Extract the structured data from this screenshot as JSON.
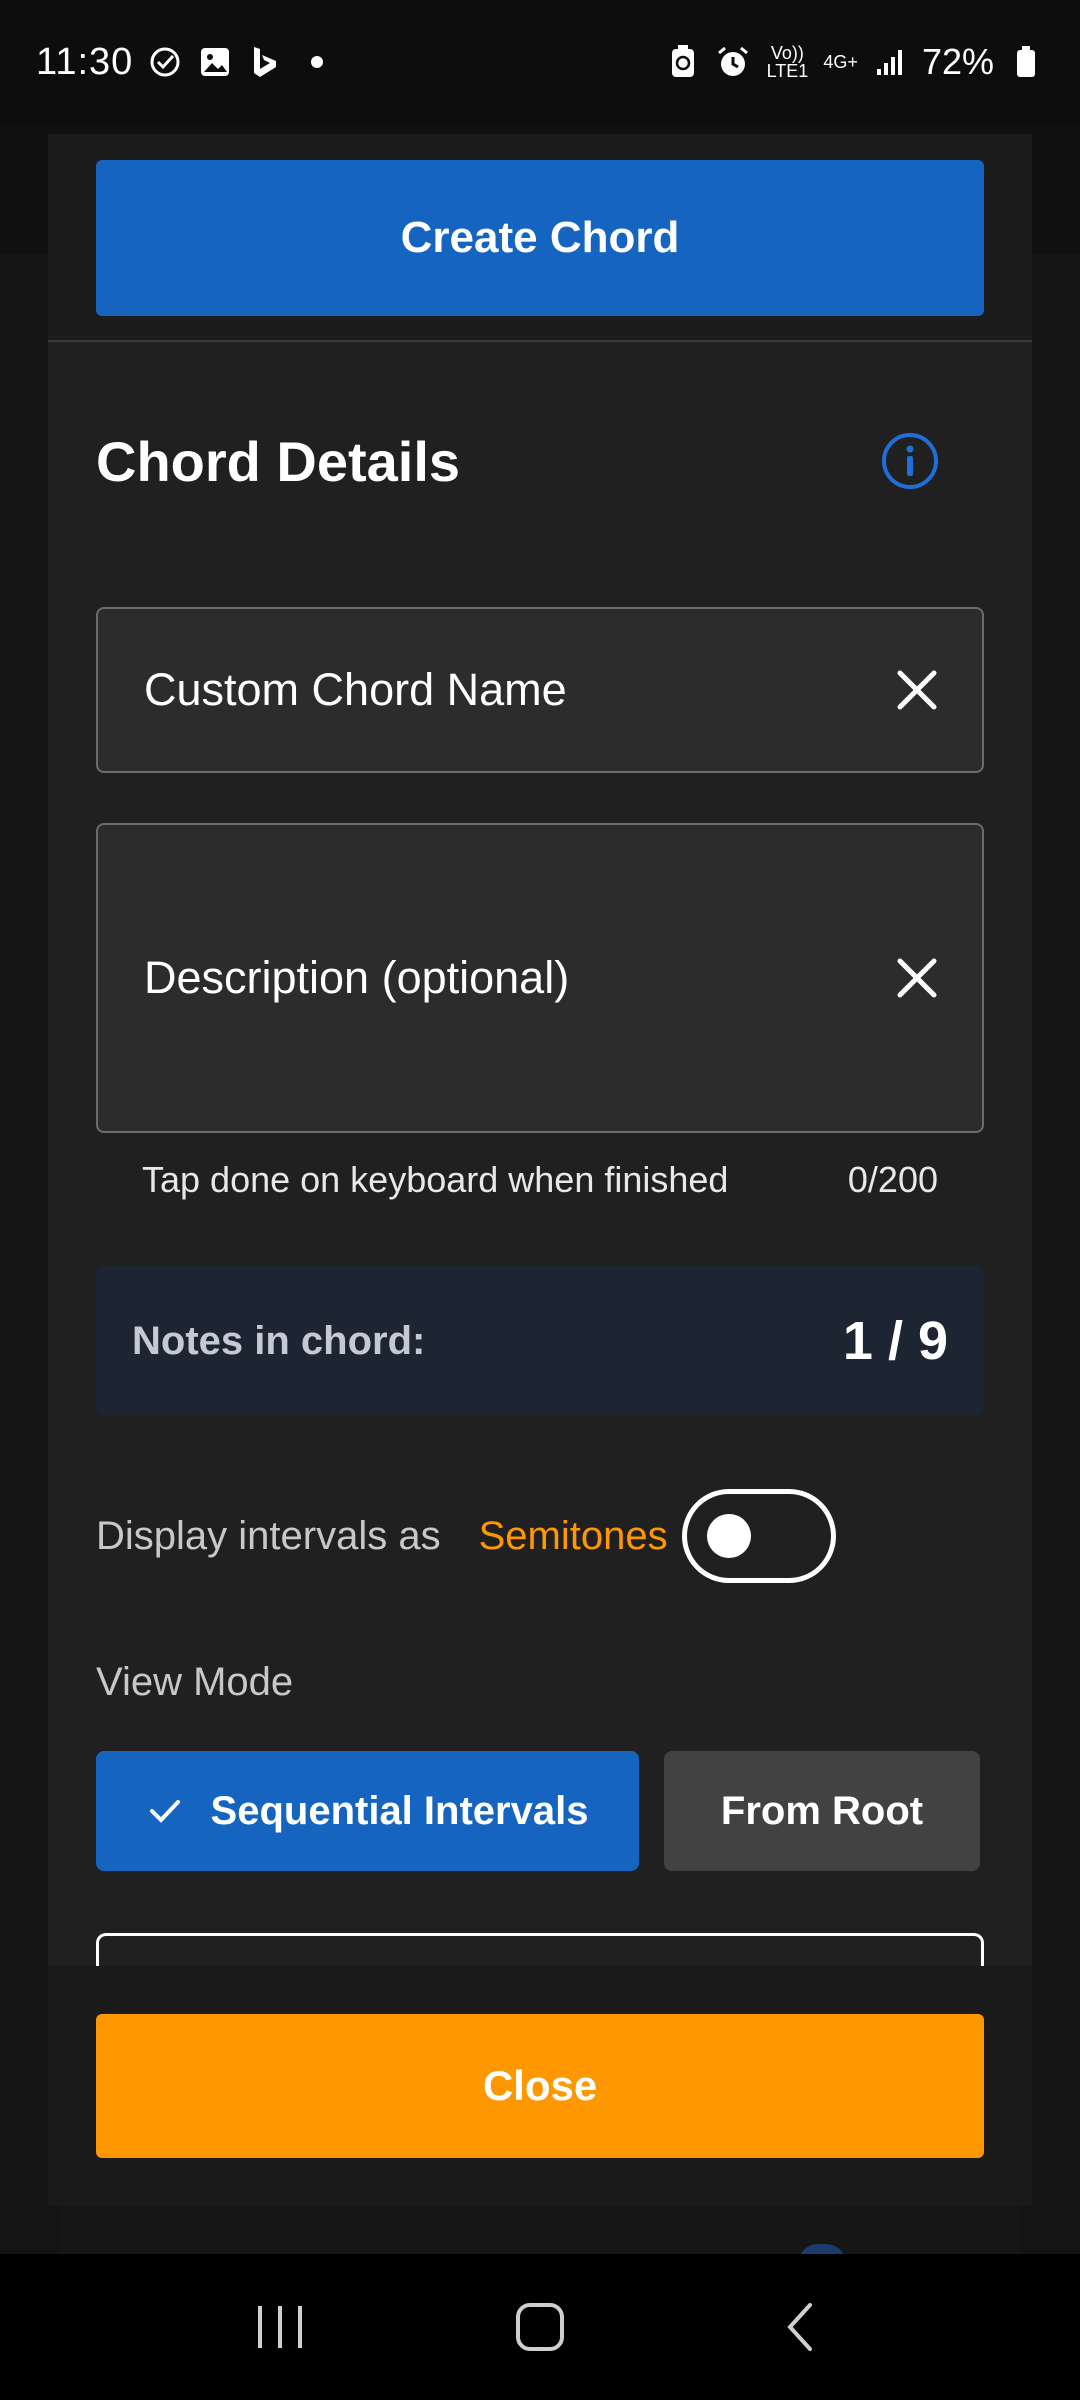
{
  "status_bar": {
    "time": "11:30",
    "left_icons": [
      "check-circle-icon",
      "gallery-icon",
      "bing-icon",
      "dot-icon"
    ],
    "network_volte": "Vo)) LTE1",
    "network_type": "4G+",
    "battery_percent": "72%"
  },
  "dialog": {
    "create_button_label": "Create Chord",
    "section_title": "Chord Details",
    "chord_name_placeholder": "Custom Chord Name",
    "description_placeholder": "Description (optional)",
    "helper_text": "Tap done on keyboard when finished",
    "char_count": "0/200",
    "notes_label": "Notes in chord:",
    "notes_count": "1 / 9",
    "display_intervals_label": "Display intervals as",
    "display_intervals_value": "Semitones",
    "toggle_on": false,
    "view_mode_label": "View Mode",
    "view_modes": [
      {
        "label": "Sequential Intervals",
        "selected": true
      },
      {
        "label": "From Root",
        "selected": false
      }
    ],
    "close_button_label": "Close"
  },
  "colors": {
    "primary_blue": "#1565c0",
    "accent_orange": "#ff9800",
    "surface": "#202020",
    "notes_card": "#1d2532"
  }
}
